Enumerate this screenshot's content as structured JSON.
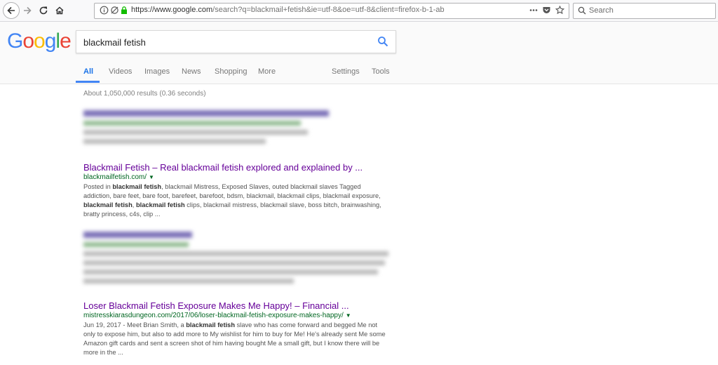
{
  "browser": {
    "url_base": "https://www.google.com",
    "url_rest": "/search?q=blackmail+fetish&ie=utf-8&oe=utf-8&client=firefox-b-1-ab",
    "search_placeholder": "Search",
    "icons": [
      "back-icon",
      "forward-icon",
      "reload-icon",
      "home-icon",
      "info-icon",
      "tracking-icon",
      "lock-icon",
      "more-icon",
      "pocket-icon",
      "bookmark-star-icon",
      "search-icon"
    ]
  },
  "google": {
    "logo": "Google",
    "query": "blackmail fetish",
    "tabs": [
      "All",
      "Videos",
      "Images",
      "News",
      "Shopping",
      "More"
    ],
    "right_tabs": [
      "Settings",
      "Tools"
    ],
    "stats": "About 1,050,000 results (0.36 seconds)"
  },
  "results": [
    {
      "title": "Blackmail Fetish – Real blackmail fetish explored and explained by ...",
      "url": "blackmailfetish.com/",
      "snippet_html": "Posted in <b>blackmail fetish</b>, blackmail Mistress, Exposed Slaves, outed blackmail slaves Tagged addiction, bare feet, bare foot, barefeet, barefoot, bdsm, blackmail, blackmail clips, blackmail exposure, <b>blackmail fetish</b>, <b>blackmail fetish</b> clips, blackmail mistress, blackmail slave, boss bitch, brainwashing, bratty princess, c4s, clip ..."
    },
    {
      "title": "Loser Blackmail Fetish Exposure Makes Me Happy! – Financial ...",
      "url": "mistresskiarasdungeon.com/2017/06/loser-blackmail-fetish-exposure-makes-happy/",
      "snippet_html": "Jun 19, 2017 - Meet Brian Smith, a <b>blackmail fetish</b> slave who has come forward and begged Me not only to expose him, but also to add more to My wishlist for him to buy for Me! He's already sent Me some Amazon gift cards and sent a screen shot of him having bought Me a small gift, but I know there will be more in the ..."
    }
  ],
  "colors": {
    "visited_link": "#660099",
    "url_green": "#006621",
    "accent_blue": "#4285f4"
  }
}
